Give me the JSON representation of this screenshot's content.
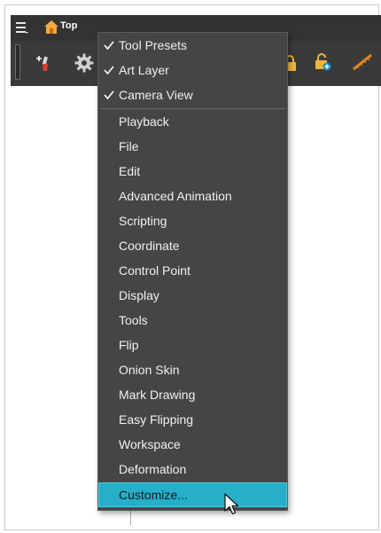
{
  "breadcrumb": {
    "label": "Top"
  },
  "menu": {
    "checked_items": [
      {
        "label": "Tool Presets"
      },
      {
        "label": "Art Layer"
      },
      {
        "label": "Camera View"
      }
    ],
    "items": [
      {
        "label": "Playback"
      },
      {
        "label": "File"
      },
      {
        "label": "Edit"
      },
      {
        "label": "Advanced Animation"
      },
      {
        "label": "Scripting"
      },
      {
        "label": "Coordinate"
      },
      {
        "label": "Control Point"
      },
      {
        "label": "Display"
      },
      {
        "label": "Tools"
      },
      {
        "label": "Flip"
      },
      {
        "label": "Onion Skin"
      },
      {
        "label": "Mark Drawing"
      },
      {
        "label": "Easy Flipping"
      },
      {
        "label": "Workspace"
      },
      {
        "label": "Deformation"
      }
    ],
    "customize": {
      "label": "Customize..."
    }
  },
  "icons": {
    "menu": "hamburger-menu-icon",
    "home": "home-icon",
    "add_brush": "add-brush-tool-icon",
    "gear": "gear-icon",
    "lock": "lock-icon",
    "lock_add": "lock-add-icon",
    "ruler": "ruler-icon",
    "check": "checkmark-icon",
    "cursor": "mouse-pointer-icon"
  },
  "colors": {
    "menu_bg": "#454545",
    "highlight": "#25afc9",
    "toolbar_bg": "#3a3a3a",
    "accent_orange": "#e8891e"
  }
}
